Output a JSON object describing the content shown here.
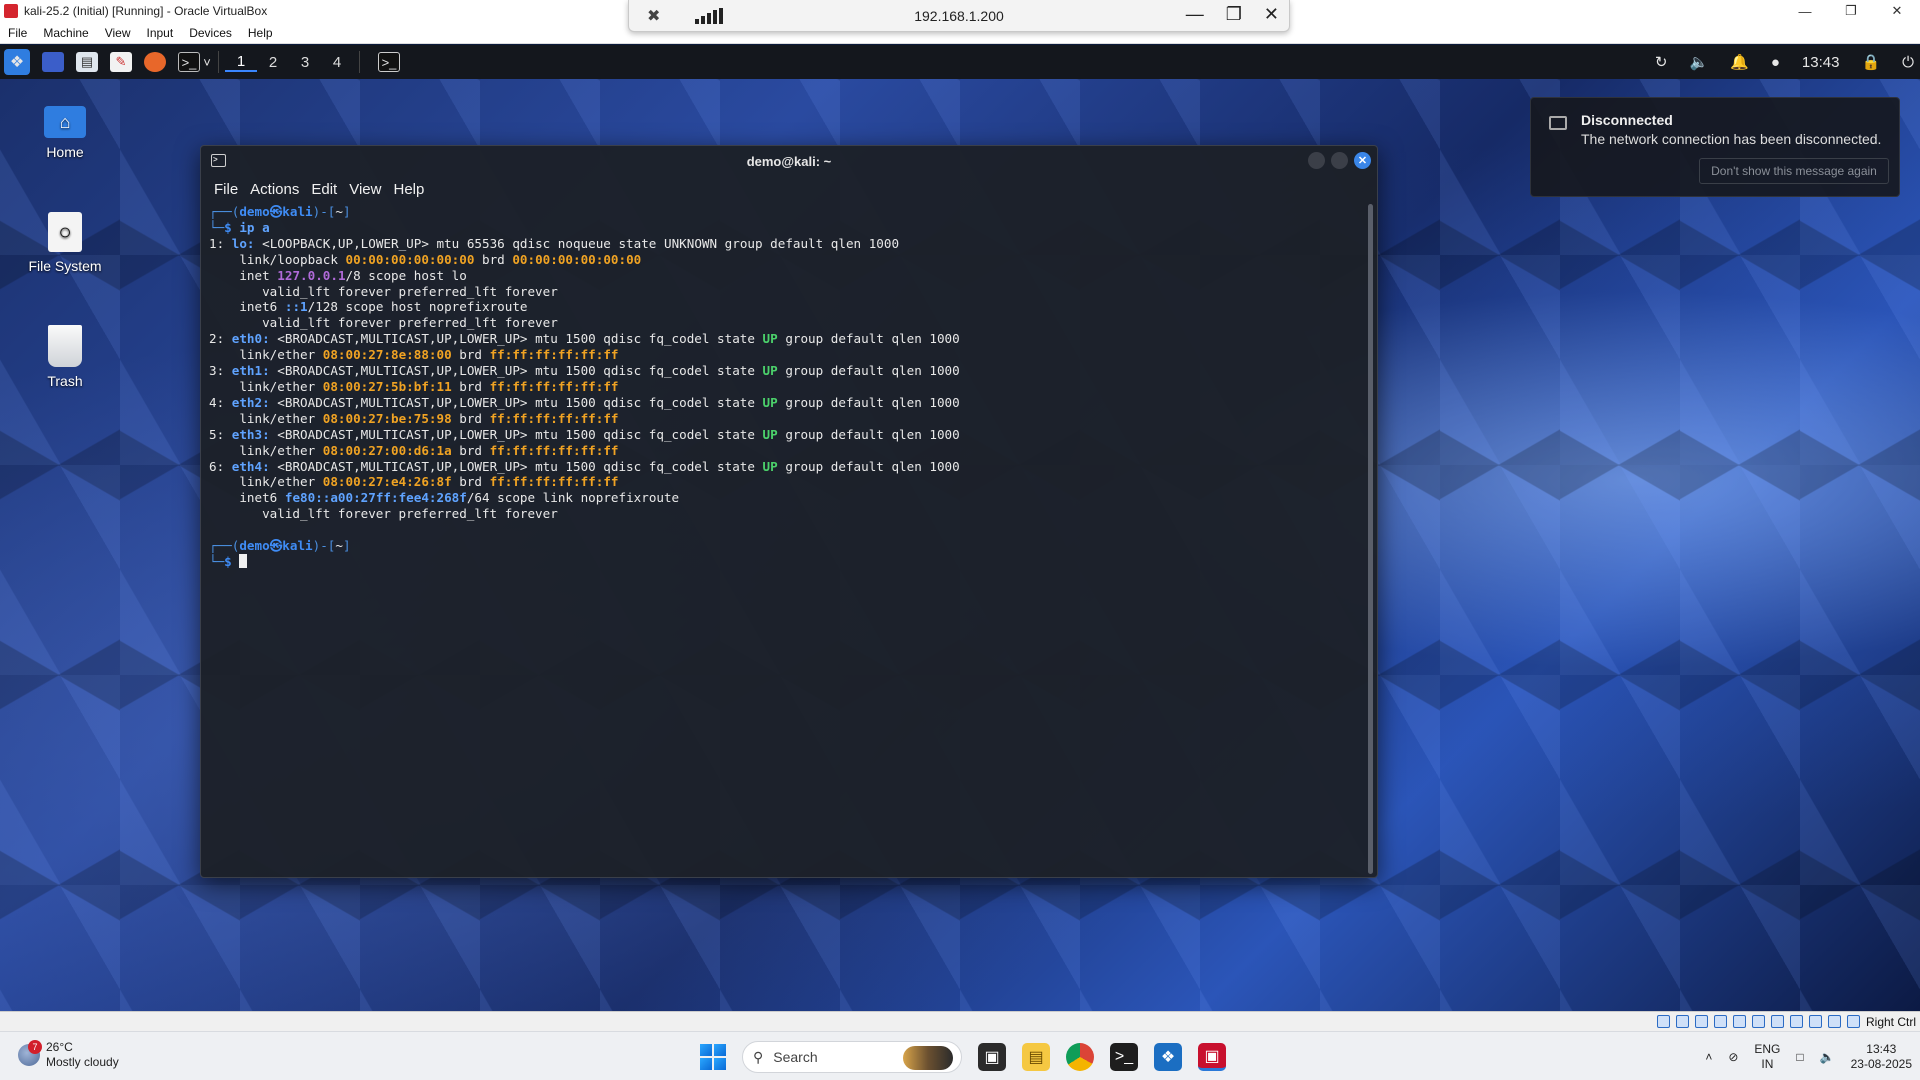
{
  "vbox": {
    "title": "kali-25.2 (Initial) [Running] - Oracle VirtualBox",
    "menu": [
      "File",
      "Machine",
      "View",
      "Input",
      "Devices",
      "Help"
    ],
    "window_controls": [
      "minimize",
      "restore",
      "close"
    ]
  },
  "remote_bar": {
    "host": "192.168.1.200"
  },
  "kali_panel": {
    "workspaces": [
      "1",
      "2",
      "3",
      "4"
    ],
    "clock": "13:43"
  },
  "desktop_icons": [
    {
      "label": "Home",
      "icon": "home-icon"
    },
    {
      "label": "File System",
      "icon": "drive-icon"
    },
    {
      "label": "Trash",
      "icon": "trash-icon"
    }
  ],
  "terminal": {
    "title": "demo@kali: ~",
    "menu": [
      "File",
      "Actions",
      "Edit",
      "View",
      "Help"
    ],
    "prompt_user": "demo",
    "prompt_host": "kali",
    "prompt_dir": "~",
    "command": "ip a",
    "interfaces": [
      {
        "index": "1:",
        "name": "lo:",
        "flags": "<LOOPBACK,UP,LOWER_UP> mtu 65536 qdisc noqueue state",
        "state": "UNKNOWN",
        "tail": "group default qlen 1000",
        "link_type": "link/loopback",
        "mac": "00:00:00:00:00:00",
        "brd": "00:00:00:00:00:00",
        "inet_label": "inet",
        "inet": "127.0.0.1",
        "inet_rest": "/8 scope host lo",
        "inet_lft": "valid_lft forever preferred_lft forever",
        "inet6_label": "inet6",
        "inet6": "::1",
        "inet6_rest": "/128 scope host noprefixroute",
        "inet6_lft": "valid_lft forever preferred_lft forever"
      },
      {
        "index": "2:",
        "name": "eth0:",
        "flags": "<BROADCAST,MULTICAST,UP,LOWER_UP> mtu 1500 qdisc fq_codel state",
        "state": "UP",
        "tail": "group default qlen 1000",
        "link_type": "link/ether",
        "mac": "08:00:27:8e:88:00",
        "brd": "ff:ff:ff:ff:ff:ff"
      },
      {
        "index": "3:",
        "name": "eth1:",
        "flags": "<BROADCAST,MULTICAST,UP,LOWER_UP> mtu 1500 qdisc fq_codel state",
        "state": "UP",
        "tail": "group default qlen 1000",
        "link_type": "link/ether",
        "mac": "08:00:27:5b:bf:11",
        "brd": "ff:ff:ff:ff:ff:ff"
      },
      {
        "index": "4:",
        "name": "eth2:",
        "flags": "<BROADCAST,MULTICAST,UP,LOWER_UP> mtu 1500 qdisc fq_codel state",
        "state": "UP",
        "tail": "group default qlen 1000",
        "link_type": "link/ether",
        "mac": "08:00:27:be:75:98",
        "brd": "ff:ff:ff:ff:ff:ff"
      },
      {
        "index": "5:",
        "name": "eth3:",
        "flags": "<BROADCAST,MULTICAST,UP,LOWER_UP> mtu 1500 qdisc fq_codel state",
        "state": "UP",
        "tail": "group default qlen 1000",
        "link_type": "link/ether",
        "mac": "08:00:27:00:d6:1a",
        "brd": "ff:ff:ff:ff:ff:ff"
      },
      {
        "index": "6:",
        "name": "eth4:",
        "flags": "<BROADCAST,MULTICAST,UP,LOWER_UP> mtu 1500 qdisc fq_codel state",
        "state": "UP",
        "tail": "group default qlen 1000",
        "link_type": "link/ether",
        "mac": "08:00:27:e4:26:8f",
        "brd": "ff:ff:ff:ff:ff:ff",
        "inet6_label": "inet6",
        "inet6": "fe80::a00:27ff:fee4:268f",
        "inet6_rest": "/64 scope link noprefixroute",
        "inet6_lft": "valid_lft forever preferred_lft forever"
      }
    ]
  },
  "notification": {
    "title": "Disconnected",
    "body": "The network connection has been disconnected.",
    "button": "Don't show this message again"
  },
  "vbox_status": {
    "host_key": "Right Ctrl"
  },
  "taskbar": {
    "weather_temp": "26°C",
    "weather_desc": "Mostly cloudy",
    "weather_badge": "7",
    "search_placeholder": "Search",
    "lang_top": "ENG",
    "lang_bottom": "IN",
    "time": "13:43",
    "date": "23-08-2025"
  },
  "colors": {
    "prompt_blue": "#3f8cf5",
    "mac_orange": "#f0a323",
    "ip_purple": "#b06ad8",
    "state_green": "#4bd16b"
  }
}
